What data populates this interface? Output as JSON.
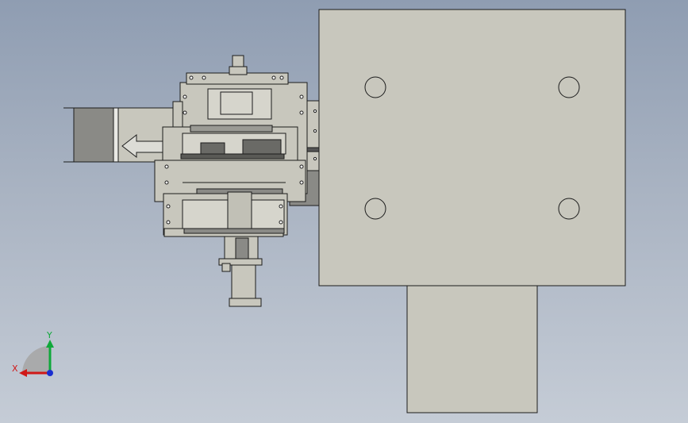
{
  "app": {
    "window_title": ""
  },
  "triad": {
    "x_label": "X",
    "y_label": "Y",
    "x_color": "#d01818",
    "y_color": "#0fa83a",
    "z_color": "#1a2ed0"
  },
  "colors": {
    "part_face": "#c8c7bd",
    "part_edge": "#1c1c1c",
    "dark_block": "#8a8a86",
    "background_top": "#8f9db2",
    "background_bottom": "#c5ccd6"
  },
  "icons": [
    "view-triad-icon"
  ]
}
